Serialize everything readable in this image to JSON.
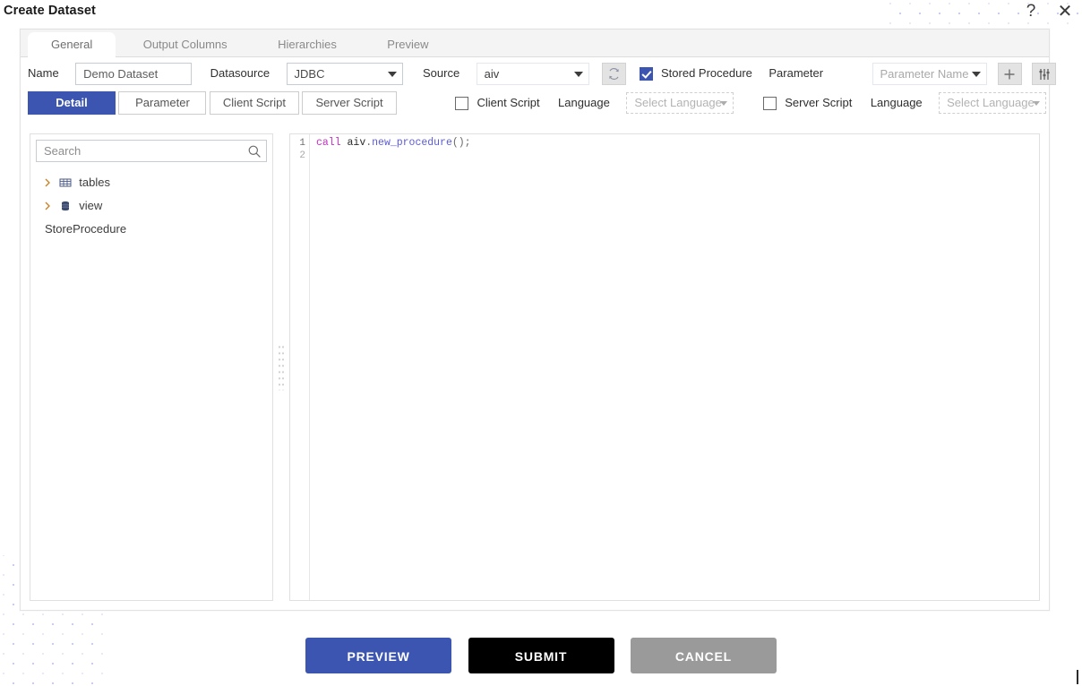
{
  "window": {
    "title": "Create Dataset",
    "help_icon": "question-mark-icon",
    "close_icon": "close-icon"
  },
  "main_tabs": [
    {
      "label": "General",
      "active": true
    },
    {
      "label": "Output Columns",
      "active": false
    },
    {
      "label": "Hierarchies",
      "active": false
    },
    {
      "label": "Preview",
      "active": false
    }
  ],
  "form": {
    "name_label": "Name",
    "name_value": "Demo Dataset",
    "name_placeholder": "Name",
    "datasource_label": "Datasource",
    "datasource_value": "JDBC",
    "source_label": "Source",
    "source_value": "aiv",
    "refresh_icon": "refresh-icon",
    "stored_procedure_label": "Stored Procedure",
    "stored_procedure_checked": true,
    "parameter_label": "Parameter",
    "parameter_name_value": "Parameter Name",
    "add_parameter_icon": "plus-icon",
    "parameter_settings_icon": "sliders-icon"
  },
  "sub_tabs": [
    {
      "label": "Detail",
      "active": true
    },
    {
      "label": "Parameter",
      "active": false
    },
    {
      "label": "Client Script",
      "active": false
    },
    {
      "label": "Server Script",
      "active": false
    }
  ],
  "script_options": {
    "client_script_label": "Client Script",
    "client_script_checked": false,
    "client_language_label": "Language",
    "client_language_value": "Select Language",
    "server_script_label": "Server Script",
    "server_script_checked": false,
    "server_language_label": "Language",
    "server_language_value": "Select Language"
  },
  "tree": {
    "search_placeholder": "Search",
    "search_value": "",
    "search_icon": "search-icon",
    "nodes": [
      {
        "label": "tables",
        "icon": "grid-table-icon",
        "expandable": true
      },
      {
        "label": "view",
        "icon": "database-stack-icon",
        "expandable": true
      },
      {
        "label": "StoreProcedure",
        "icon": "",
        "expandable": false
      }
    ]
  },
  "editor": {
    "line_numbers": [
      "1",
      "2"
    ],
    "code_tokens": [
      {
        "text": "call",
        "type": "keyword"
      },
      {
        "text": " ",
        "type": "plain"
      },
      {
        "text": "aiv",
        "type": "identifier"
      },
      {
        "text": ".",
        "type": "punct"
      },
      {
        "text": "new_procedure",
        "type": "function"
      },
      {
        "text": "();",
        "type": "punct"
      }
    ],
    "code_plain": "call aiv.new_procedure();"
  },
  "footer": {
    "preview_label": "PREVIEW",
    "submit_label": "SUBMIT",
    "cancel_label": "CANCEL"
  },
  "colors": {
    "accent": "#3b55b0",
    "submit": "#000000",
    "cancel": "#9a9a9a",
    "dots": "#c9cdf0"
  }
}
